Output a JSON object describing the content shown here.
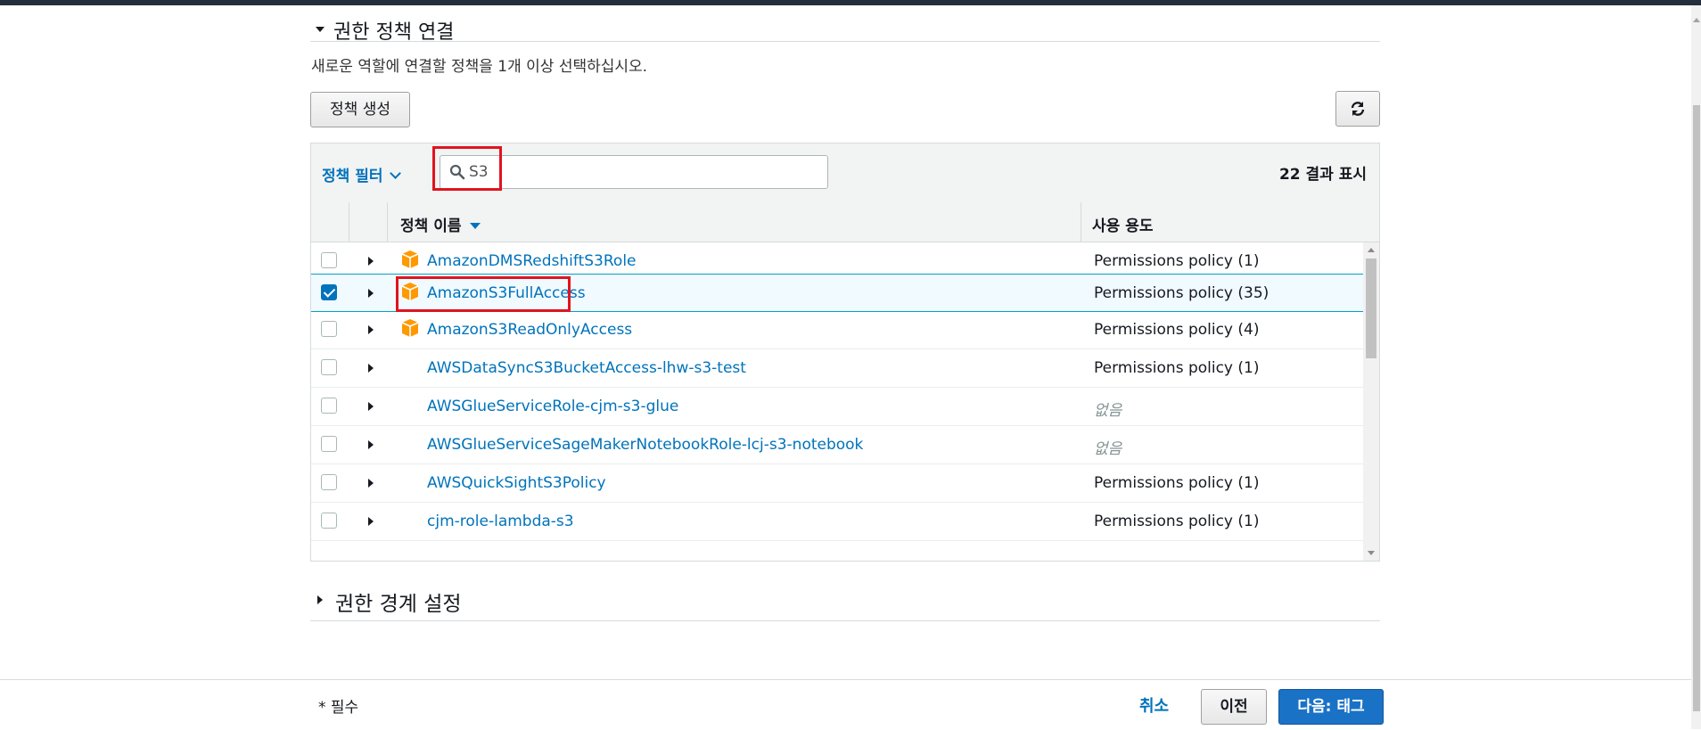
{
  "section": {
    "title": "권한 정책 연결",
    "description": "새로운 역할에 연결할 정책을 1개 이상 선택하십시오."
  },
  "toolbar": {
    "create_policy_label": "정책 생성",
    "refresh_icon": "refresh-icon"
  },
  "filter": {
    "label": "정책 필터",
    "search_value": "S3",
    "results_text": "22 결과 표시"
  },
  "table": {
    "columns": {
      "name": "정책 이름",
      "usage": "사용 용도"
    },
    "rows": [
      {
        "name": "AmazonDMSRedshiftS3Role",
        "usage": "Permissions policy (1)",
        "aws_managed": true,
        "checked": false
      },
      {
        "name": "AmazonS3FullAccess",
        "usage": "Permissions policy (35)",
        "aws_managed": true,
        "checked": true
      },
      {
        "name": "AmazonS3ReadOnlyAccess",
        "usage": "Permissions policy (4)",
        "aws_managed": true,
        "checked": false
      },
      {
        "name": "AWSDataSyncS3BucketAccess-lhw-s3-test",
        "usage": "Permissions policy (1)",
        "aws_managed": false,
        "checked": false
      },
      {
        "name": "AWSGlueServiceRole-cjm-s3-glue",
        "usage": "없음",
        "aws_managed": false,
        "checked": false
      },
      {
        "name": "AWSGlueServiceSageMakerNotebookRole-lcj-s3-notebook",
        "usage": "없음",
        "aws_managed": false,
        "checked": false
      },
      {
        "name": "AWSQuickSightS3Policy",
        "usage": "Permissions policy (1)",
        "aws_managed": false,
        "checked": false
      },
      {
        "name": "cjm-role-lambda-s3",
        "usage": "Permissions policy (1)",
        "aws_managed": false,
        "checked": false
      }
    ]
  },
  "boundary": {
    "title": "권한 경계 설정"
  },
  "footer": {
    "required": "* 필수",
    "cancel": "취소",
    "previous": "이전",
    "next": "다음: 태그"
  },
  "colors": {
    "link": "#0073bb",
    "primary_button": "#1a72c6",
    "highlight_box": "#e0141e",
    "aws_icon": "#f90"
  }
}
